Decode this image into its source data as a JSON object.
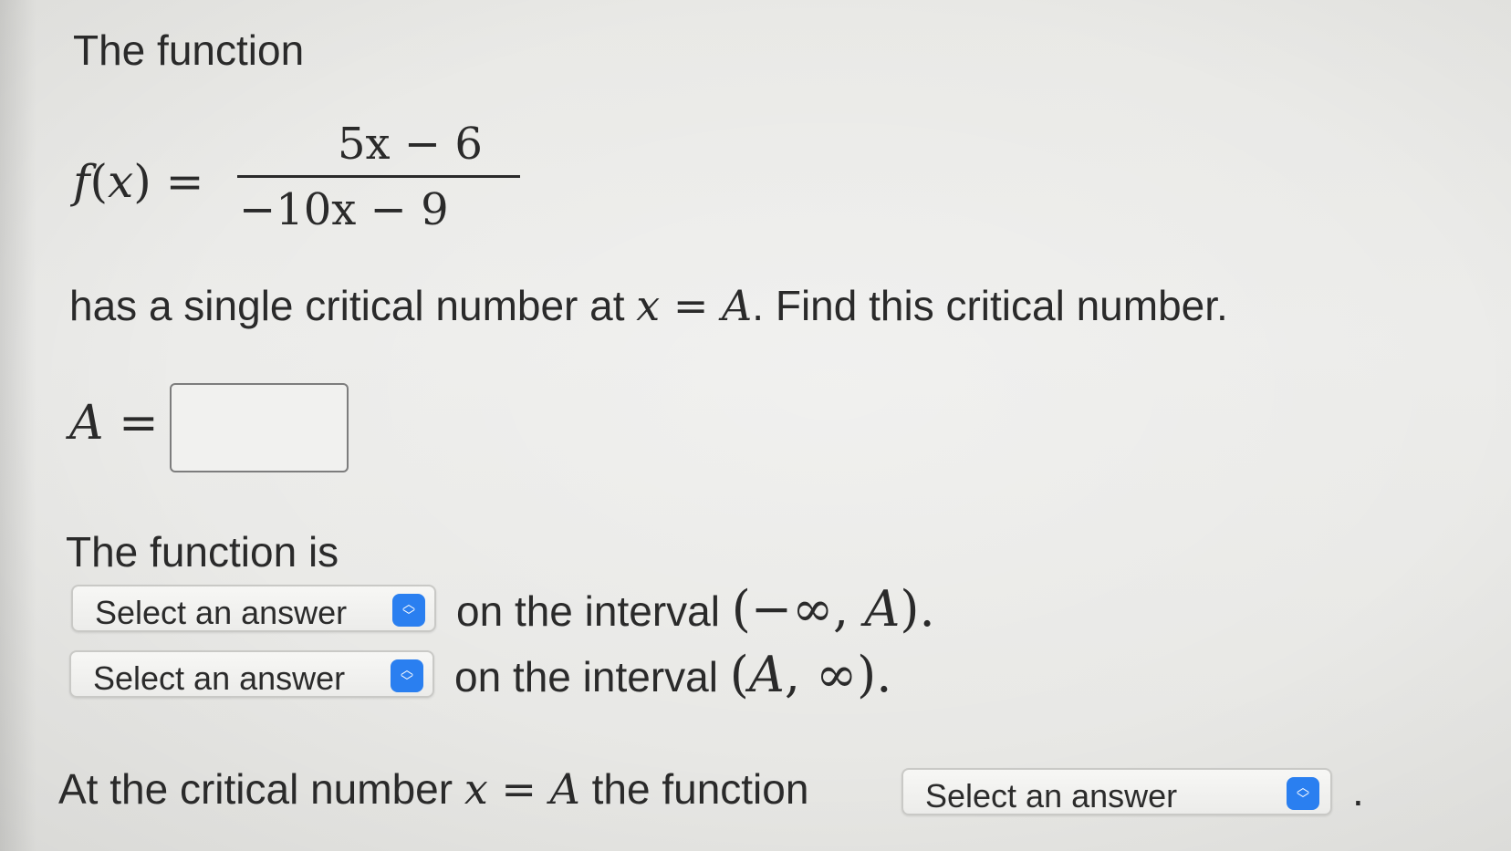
{
  "intro_text": "The function",
  "formula": {
    "lhs_f": "f",
    "lhs_open": "(",
    "lhs_x": "x",
    "lhs_close_eq": ") =",
    "numerator": "5x − 6",
    "denominator": "−10x − 9"
  },
  "statement": {
    "prefix": "has a single critical number at ",
    "var_x": "x",
    "eq": " = ",
    "var_A": "A",
    "suffix": ". Find this critical number."
  },
  "answer": {
    "label_A": "A",
    "label_eq": " =",
    "value": ""
  },
  "function_is_text": "The function is",
  "select_placeholder": "Select an answer",
  "interval1": {
    "prefix": "on the interval ",
    "open": "(−∞, ",
    "var": "A",
    "close": ")."
  },
  "interval2": {
    "prefix": "on the interval ",
    "open": "(",
    "var": "A",
    "close": ", ∞)."
  },
  "final": {
    "prefix": "At the critical number ",
    "var_x": "x",
    "eq": " = ",
    "var_A": "A",
    "suffix": " the function",
    "end": "."
  },
  "icons": {
    "select_stepper": "up-down-chevron-icon"
  },
  "colors": {
    "background": "#eaeae7",
    "text": "#2a2a2a",
    "select_icon": "#2a7ff0",
    "select_border": "#c9c9c6"
  }
}
